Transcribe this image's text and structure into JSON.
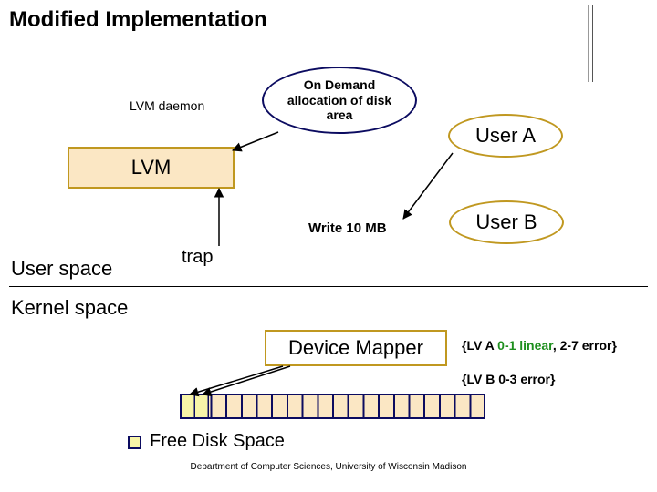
{
  "title": "Modified Implementation",
  "lvm_daemon_label": "LVM daemon",
  "balloon_text": "On Demand allocation of disk area",
  "lvm_box_label": "LVM",
  "trap_label": "trap",
  "write_label": "Write 10 MB",
  "users": {
    "a": "User A",
    "b": "User B"
  },
  "userspace_label": "User space",
  "kernelspace_label": "Kernel space",
  "device_mapper_label": "Device Mapper",
  "mapping_a": {
    "prefix": "{LV A ",
    "linear": "0-1 linear",
    "rest": ", 2-7 error}"
  },
  "mapping_b": "{LV B 0-3 error}",
  "legend_label": "Free Disk Space",
  "footer": "Department of Computer Sciences, University of Wisconsin Madison",
  "colors": {
    "box_border": "#c09820",
    "box_fill": "#fbe7c4",
    "navy": "#0b0b60",
    "free": "#f7f4a8",
    "green": "#1e8f1e"
  }
}
